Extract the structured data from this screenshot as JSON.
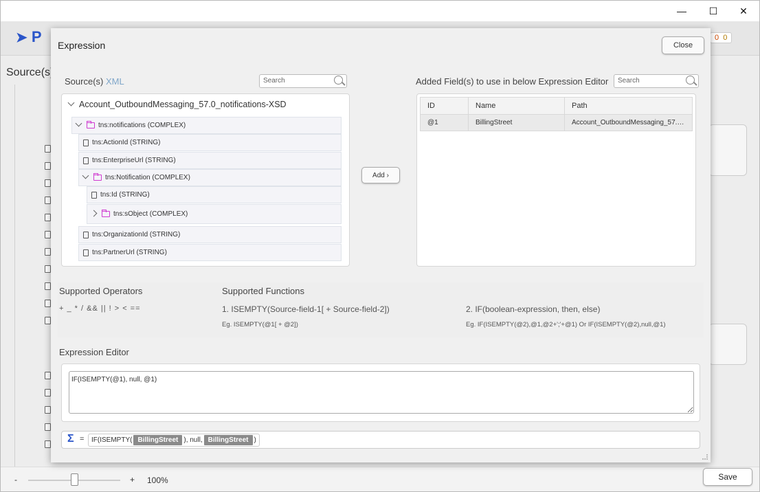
{
  "window": {
    "minimize_glyph": "—",
    "maximize_glyph": "☐",
    "close_glyph": "✕"
  },
  "app": {
    "sources_label": "Source(s)",
    "logo_text": "P",
    "save_label": "Save",
    "zoom_minus": "-",
    "zoom_plus": "+",
    "zoom_value": "100%",
    "zoom_percent": 50,
    "badge_a": "0",
    "badge_b": "0"
  },
  "modal": {
    "title": "Expression",
    "close_label": "Close",
    "sources": {
      "label": "Source(s)",
      "badge": "XML",
      "search_placeholder": "Search"
    },
    "tree": {
      "root": "Account_OutboundMessaging_57.0_notifications-XSD",
      "nodes": [
        {
          "label": "tns:notifications (COMPLEX)"
        },
        {
          "label": "tns:ActionId (STRING)"
        },
        {
          "label": "tns:EnterpriseUrl (STRING)"
        },
        {
          "label": "tns:Notification (COMPLEX)"
        },
        {
          "label": "tns:Id (STRING)"
        },
        {
          "label": "tns:sObject (COMPLEX)"
        },
        {
          "label": "tns:OrganizationId (STRING)"
        },
        {
          "label": "tns:PartnerUrl (STRING)"
        }
      ]
    },
    "add_label": "Add ›",
    "added": {
      "label": "Added Field(s) to use in below Expression Editor",
      "search_placeholder": "Search",
      "columns": [
        "ID",
        "Name",
        "Path"
      ],
      "rows": [
        {
          "id": "@1",
          "name": "BillingStreet",
          "path": "Account_OutboundMessaging_57.0..."
        }
      ]
    },
    "operators": {
      "title": "Supported Operators",
      "list": "+ _ * / && || ! > < =="
    },
    "functions": {
      "title": "Supported Functions",
      "f1": "1. ISEMPTY(Source-field-1[ + Source-field-2])",
      "f1_eg": "Eg. ISEMPTY(@1[ + @2])",
      "f2": "2. IF(boolean-expression, then, else)",
      "f2_eg": "Eg. IF(ISEMPTY(@2),@1,@2+';'+@1) Or IF(ISEMPTY(@2),null,@1)"
    },
    "editor": {
      "title": "Expression Editor",
      "value": "IF(ISEMPTY(@1), null, @1)"
    },
    "result": {
      "sigma": "Σ",
      "eq": "=",
      "p1": "IF(ISEMPTY(",
      "chip1": "BillingStreet",
      "p2": "), null,",
      "chip2": "BillingStreet",
      "p3": ")"
    }
  }
}
